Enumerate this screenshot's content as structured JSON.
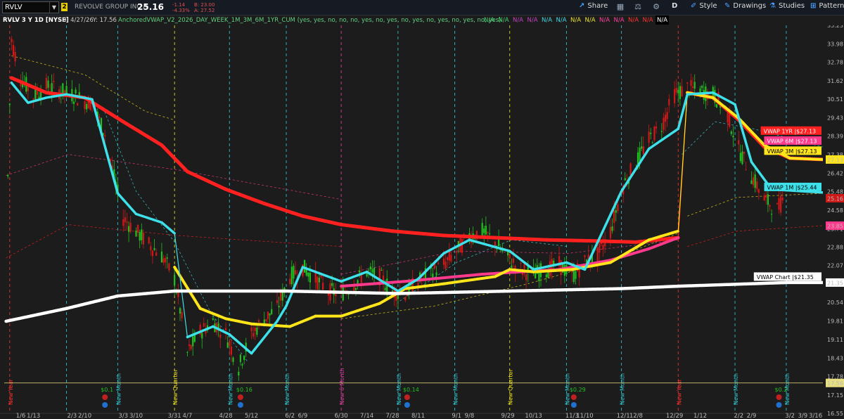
{
  "toolbar": {
    "symbol": "RVLV",
    "link_number": "2",
    "company": "REVOLVE GROUP INC A",
    "last_price": "25.16",
    "net_change": "-1.14",
    "pct_change": "-4.33%",
    "bid": "B: 23.00",
    "ask": "A: 27.52",
    "share_label": "Share",
    "aggregation_label": "D",
    "style_label": "Style",
    "drawings_label": "Drawings",
    "studies_label": "Studies",
    "patterns_label": "Patterns"
  },
  "study_header": {
    "chart_title": "RVLV 3 Y 1D [NYSE]",
    "date_info": "D: 4/27/26",
    "y_info": "Y: 17.56",
    "study_text": "AnchoredVWAP_V2_2026_DAY_WEEK_1M_3M_6M_1YR_CUM (yes, yes, no, no, no, yes, no, yes, no, yes, no, yes, no, yes, no, yes)",
    "na_values": [
      {
        "text": "N/A",
        "color": "#40d070",
        "bg": "none"
      },
      {
        "text": "N/A",
        "color": "#40d070",
        "bg": "none"
      },
      {
        "text": "N/A",
        "color": "#c040c0",
        "bg": "none"
      },
      {
        "text": "N/A",
        "color": "#c040c0",
        "bg": "none"
      },
      {
        "text": "N/A",
        "color": "#40d8e8",
        "bg": "none"
      },
      {
        "text": "N/A",
        "color": "#40d8e8",
        "bg": "none"
      },
      {
        "text": "N/A",
        "color": "#e8e030",
        "bg": "none"
      },
      {
        "text": "N/A",
        "color": "#e8e030",
        "bg": "none"
      },
      {
        "text": "N/A",
        "color": "#ff40a0",
        "bg": "none"
      },
      {
        "text": "N/A",
        "color": "#ff40a0",
        "bg": "none"
      },
      {
        "text": "N/A",
        "color": "#ff3030",
        "bg": "none"
      },
      {
        "text": "N/A",
        "color": "#ff3030",
        "bg": "none"
      },
      {
        "text": "N/A",
        "color": "#ffffff",
        "bg": "none"
      }
    ]
  },
  "colors": {
    "background": "#1c1c1c",
    "up_candle": "#20c020",
    "down_candle": "#d01818",
    "vwap_1yr": "#ff2020",
    "vwap_6m": "#ff3a8c",
    "vwap_3m": "#ffe51a",
    "vwap_1m": "#3ee0ea",
    "vwap_chart": "#ffffff",
    "new_month": "#30c8d0",
    "new_quarter": "#e8e020",
    "new_6month": "#e040a0",
    "new_year": "#ff3030"
  },
  "chart_data": {
    "type": "candlestick",
    "y_range": [
      16.55,
      35.23
    ],
    "y_ticks": [
      35.23,
      33.98,
      32.78,
      31.62,
      30.51,
      29.43,
      28.39,
      27.38,
      26.42,
      25.48,
      24.58,
      23.71,
      22.88,
      22.07,
      21.3,
      20.54,
      19.81,
      19.11,
      18.43,
      17.78,
      17.15,
      16.55
    ],
    "x_range": [
      "2024-12-28",
      "2026-03-20"
    ],
    "x_ticks": [
      {
        "label": "1/6",
        "date": "2025-01-06"
      },
      {
        "label": "1/13",
        "date": "2025-01-13"
      },
      {
        "label": "2/3",
        "date": "2025-02-03"
      },
      {
        "label": "2/10",
        "date": "2025-02-10"
      },
      {
        "label": "3/3",
        "date": "2025-03-03"
      },
      {
        "label": "3/10",
        "date": "2025-03-10"
      },
      {
        "label": "3/31",
        "date": "2025-03-31"
      },
      {
        "label": "4/7",
        "date": "2025-04-07"
      },
      {
        "label": "4/28",
        "date": "2025-04-28"
      },
      {
        "label": "5/12",
        "date": "2025-05-12"
      },
      {
        "label": "6/2",
        "date": "2025-06-02"
      },
      {
        "label": "6/9",
        "date": "2025-06-09"
      },
      {
        "label": "6/30",
        "date": "2025-06-30"
      },
      {
        "label": "7/14",
        "date": "2025-07-14"
      },
      {
        "label": "7/28",
        "date": "2025-07-28"
      },
      {
        "label": "8/11",
        "date": "2025-08-11"
      },
      {
        "label": "9/1",
        "date": "2025-09-01"
      },
      {
        "label": "9/8",
        "date": "2025-09-08"
      },
      {
        "label": "9/29",
        "date": "2025-09-29"
      },
      {
        "label": "10/13",
        "date": "2025-10-13"
      },
      {
        "label": "11/3",
        "date": "2025-11-03"
      },
      {
        "label": "11/10",
        "date": "2025-11-10"
      },
      {
        "label": "12/1",
        "date": "2025-12-01"
      },
      {
        "label": "12/8",
        "date": "2025-12-08"
      },
      {
        "label": "12/29",
        "date": "2025-12-29"
      },
      {
        "label": "1/12",
        "date": "2026-01-12"
      },
      {
        "label": "2/2",
        "date": "2026-02-02"
      },
      {
        "label": "2/9",
        "date": "2026-02-09"
      },
      {
        "label": "3/2",
        "date": "2026-03-02"
      },
      {
        "label": "3/9",
        "date": "2026-03-09"
      },
      {
        "label": "3/16",
        "date": "2026-03-16"
      }
    ],
    "period_markers": [
      {
        "label": "New Year",
        "type": "year",
        "date": "2024-12-31"
      },
      {
        "label": "",
        "type": "month",
        "date": "2025-01-31"
      },
      {
        "label": "New Month",
        "type": "month",
        "date": "2025-02-28"
      },
      {
        "label": "New Quarter",
        "type": "quarter",
        "date": "2025-03-31"
      },
      {
        "label": "New Month",
        "type": "month",
        "date": "2025-04-30"
      },
      {
        "label": "New Month",
        "type": "month",
        "date": "2025-05-31"
      },
      {
        "label": "New 6 Month",
        "type": "halfyear",
        "date": "2025-06-30"
      },
      {
        "label": "New Month",
        "type": "month",
        "date": "2025-07-31"
      },
      {
        "label": "New Month",
        "type": "month",
        "date": "2025-08-31"
      },
      {
        "label": "New Quarter",
        "type": "quarter",
        "date": "2025-09-30"
      },
      {
        "label": "New Month",
        "type": "month",
        "date": "2025-10-31"
      },
      {
        "label": "New Month",
        "type": "month",
        "date": "2025-11-30"
      },
      {
        "label": "New Year",
        "type": "year",
        "date": "2025-12-31"
      },
      {
        "label": "New Month",
        "type": "month",
        "date": "2026-01-31"
      },
      {
        "label": "New Month",
        "type": "month",
        "date": "2026-02-28"
      }
    ],
    "earnings_events": [
      {
        "label": "$0.1",
        "date": "2025-02-21",
        "icon": "E"
      },
      {
        "label": "$0.16",
        "date": "2025-05-06",
        "icon": "E"
      },
      {
        "label": "$0.14",
        "date": "2025-08-05",
        "icon": "E"
      },
      {
        "label": "$0.29",
        "date": "2025-11-04",
        "icon": "E"
      },
      {
        "label": "$0.2",
        "date": "2026-02-24",
        "icon": "E"
      }
    ],
    "series": [
      {
        "name": "Price",
        "points": [
          [
            "2024-12-29",
            22.3
          ],
          [
            "2025-01-01",
            34.2
          ],
          [
            "2025-01-06",
            31.8
          ],
          [
            "2025-01-13",
            30.7
          ],
          [
            "2025-01-20",
            31.3
          ],
          [
            "2025-02-03",
            30.8
          ],
          [
            "2025-02-10",
            30.4
          ],
          [
            "2025-02-14",
            30.3
          ],
          [
            "2025-02-21",
            28.5
          ],
          [
            "2025-02-26",
            26.2
          ],
          [
            "2025-03-03",
            24.2
          ],
          [
            "2025-03-10",
            23.6
          ],
          [
            "2025-03-17",
            23.0
          ],
          [
            "2025-03-24",
            22.5
          ],
          [
            "2025-03-31",
            21.5
          ],
          [
            "2025-04-07",
            18.6
          ],
          [
            "2025-04-14",
            19.4
          ],
          [
            "2025-04-21",
            19.8
          ],
          [
            "2025-04-28",
            19.3
          ],
          [
            "2025-05-05",
            18.1
          ],
          [
            "2025-05-12",
            19.3
          ],
          [
            "2025-05-19",
            19.9
          ],
          [
            "2025-05-26",
            20.3
          ],
          [
            "2025-06-02",
            21.6
          ],
          [
            "2025-06-09",
            22.0
          ],
          [
            "2025-06-16",
            21.5
          ],
          [
            "2025-06-23",
            21.0
          ],
          [
            "2025-06-30",
            20.9
          ],
          [
            "2025-07-07",
            21.3
          ],
          [
            "2025-07-14",
            21.8
          ],
          [
            "2025-07-21",
            21.6
          ],
          [
            "2025-07-28",
            21.0
          ],
          [
            "2025-08-04",
            20.9
          ],
          [
            "2025-08-11",
            21.4
          ],
          [
            "2025-08-18",
            21.8
          ],
          [
            "2025-08-25",
            22.1
          ],
          [
            "2025-09-01",
            22.7
          ],
          [
            "2025-09-08",
            23.4
          ],
          [
            "2025-09-15",
            23.6
          ],
          [
            "2025-09-22",
            23.1
          ],
          [
            "2025-09-29",
            22.4
          ],
          [
            "2025-10-06",
            21.9
          ],
          [
            "2025-10-13",
            21.7
          ],
          [
            "2025-10-20",
            21.9
          ],
          [
            "2025-10-27",
            22.1
          ],
          [
            "2025-11-03",
            21.6
          ],
          [
            "2025-11-10",
            22.2
          ],
          [
            "2025-11-17",
            22.5
          ],
          [
            "2025-11-24",
            23.6
          ],
          [
            "2025-12-01",
            25.8
          ],
          [
            "2025-12-08",
            27.0
          ],
          [
            "2025-12-15",
            28.2
          ],
          [
            "2025-12-22",
            29.0
          ],
          [
            "2025-12-29",
            30.8
          ],
          [
            "2026-01-05",
            31.2
          ],
          [
            "2026-01-12",
            31.0
          ],
          [
            "2026-01-19",
            30.8
          ],
          [
            "2026-01-26",
            29.9
          ],
          [
            "2026-02-02",
            27.7
          ],
          [
            "2026-02-09",
            26.3
          ],
          [
            "2026-02-16",
            25.1
          ],
          [
            "2026-02-23",
            24.6
          ],
          [
            "2026-02-27",
            25.2
          ]
        ]
      },
      {
        "name": "VWAP 1YR",
        "last_value": "27.13",
        "points": [
          [
            "2025-01-01",
            31.8
          ],
          [
            "2025-01-20",
            30.9
          ],
          [
            "2025-02-10",
            30.6
          ],
          [
            "2025-03-03",
            29.2
          ],
          [
            "2025-03-24",
            27.9
          ],
          [
            "2025-04-07",
            26.5
          ],
          [
            "2025-04-28",
            25.6
          ],
          [
            "2025-05-19",
            24.9
          ],
          [
            "2025-06-09",
            24.3
          ],
          [
            "2025-06-30",
            23.9
          ],
          [
            "2025-07-28",
            23.6
          ],
          [
            "2025-08-25",
            23.4
          ],
          [
            "2025-09-22",
            23.3
          ],
          [
            "2025-10-20",
            23.2
          ],
          [
            "2025-11-17",
            23.15
          ],
          [
            "2025-12-08",
            23.1
          ],
          [
            "2025-12-31",
            23.3
          ],
          [
            "2026-01-05",
            30.9
          ],
          [
            "2026-01-19",
            30.6
          ],
          [
            "2026-02-02",
            29.3
          ],
          [
            "2026-02-16",
            27.8
          ],
          [
            "2026-03-02",
            27.2
          ],
          [
            "2026-03-20",
            27.13
          ]
        ]
      },
      {
        "name": "VWAP 6M",
        "last_value": "27.13",
        "points": [
          [
            "2025-06-30",
            21.2
          ],
          [
            "2025-08-04",
            21.4
          ],
          [
            "2025-09-15",
            21.7
          ],
          [
            "2025-10-27",
            21.9
          ],
          [
            "2025-11-24",
            22.3
          ],
          [
            "2025-12-15",
            22.8
          ],
          [
            "2025-12-31",
            23.3
          ]
        ]
      },
      {
        "name": "VWAP 3M",
        "last_value": "27.13",
        "points": [
          [
            "2025-03-31",
            22.0
          ],
          [
            "2025-04-14",
            20.3
          ],
          [
            "2025-04-28",
            19.9
          ],
          [
            "2025-05-12",
            19.7
          ],
          [
            "2025-06-02",
            19.6
          ],
          [
            "2025-06-16",
            20.0
          ],
          [
            "2025-06-30",
            20.0
          ],
          [
            "2025-07-21",
            20.5
          ],
          [
            "2025-08-04",
            21.1
          ],
          [
            "2025-08-25",
            21.3
          ],
          [
            "2025-09-22",
            21.6
          ],
          [
            "2025-09-30",
            21.9
          ],
          [
            "2025-10-13",
            21.8
          ],
          [
            "2025-11-03",
            21.9
          ],
          [
            "2025-11-24",
            22.2
          ],
          [
            "2025-12-15",
            23.2
          ],
          [
            "2025-12-31",
            23.6
          ],
          [
            "2026-01-05",
            30.9
          ],
          [
            "2026-01-19",
            30.6
          ],
          [
            "2026-02-02",
            29.4
          ],
          [
            "2026-02-16",
            27.9
          ],
          [
            "2026-03-02",
            27.2
          ],
          [
            "2026-03-20",
            27.13
          ]
        ]
      },
      {
        "name": "VWAP 1M",
        "last_value": "25.44",
        "points": [
          [
            "2025-01-01",
            31.5
          ],
          [
            "2025-01-10",
            30.3
          ],
          [
            "2025-01-20",
            30.6
          ],
          [
            "2025-01-31",
            30.8
          ],
          [
            "2025-02-14",
            30.5
          ],
          [
            "2025-02-28",
            25.4
          ],
          [
            "2025-03-10",
            24.4
          ],
          [
            "2025-03-24",
            24.0
          ],
          [
            "2025-03-31",
            23.5
          ],
          [
            "2025-04-07",
            19.2
          ],
          [
            "2025-04-21",
            19.6
          ],
          [
            "2025-04-30",
            19.3
          ],
          [
            "2025-05-12",
            18.6
          ],
          [
            "2025-05-26",
            19.8
          ],
          [
            "2025-05-31",
            20.4
          ],
          [
            "2025-06-09",
            22.0
          ],
          [
            "2025-06-30",
            21.4
          ],
          [
            "2025-07-14",
            21.8
          ],
          [
            "2025-07-31",
            21.0
          ],
          [
            "2025-08-11",
            21.5
          ],
          [
            "2025-08-25",
            22.6
          ],
          [
            "2025-09-08",
            23.2
          ],
          [
            "2025-09-30",
            22.7
          ],
          [
            "2025-10-13",
            21.9
          ],
          [
            "2025-10-31",
            22.2
          ],
          [
            "2025-11-10",
            21.9
          ],
          [
            "2025-11-30",
            25.5
          ],
          [
            "2025-12-15",
            27.7
          ],
          [
            "2025-12-31",
            28.8
          ],
          [
            "2026-01-05",
            30.8
          ],
          [
            "2026-01-19",
            30.9
          ],
          [
            "2026-01-31",
            30.2
          ],
          [
            "2026-02-09",
            27.0
          ],
          [
            "2026-02-20",
            25.6
          ],
          [
            "2026-03-20",
            25.44
          ]
        ]
      },
      {
        "name": "VWAP Chart",
        "last_value": "21.35",
        "points": [
          [
            "2024-12-29",
            19.8
          ],
          [
            "2025-01-31",
            20.3
          ],
          [
            "2025-02-28",
            20.8
          ],
          [
            "2025-03-31",
            21.0
          ],
          [
            "2025-05-31",
            21.0
          ],
          [
            "2025-07-31",
            20.9
          ],
          [
            "2025-09-30",
            21.0
          ],
          [
            "2025-11-30",
            21.1
          ],
          [
            "2025-12-31",
            21.2
          ],
          [
            "2026-02-28",
            21.35
          ],
          [
            "2026-03-20",
            21.35
          ]
        ]
      }
    ],
    "price_labels": [
      {
        "text": "27.13",
        "value": 27.13,
        "color": "#ffe51a"
      },
      {
        "text": "25.16",
        "value": 25.16,
        "color": "#d01818"
      },
      {
        "text": "23.85",
        "value": 23.85,
        "color": "#ff3a8c"
      },
      {
        "text": "21.35",
        "value": 21.35,
        "color": "#ffffff"
      },
      {
        "text": "17.56",
        "value": 17.56,
        "color": "#e8e080"
      }
    ],
    "vwap_labels": [
      {
        "text": "VWAP 1YR |$27.13",
        "value": 28.7,
        "color": "#ff2020"
      },
      {
        "text": "VWAP 6M |$27.13",
        "value": 28.15,
        "color": "#ff3a8c"
      },
      {
        "text": "VWAP 3M |$27.13",
        "value": 27.6,
        "color": "#ffe51a"
      },
      {
        "text": "VWAP 1M |$25.44",
        "value": 25.72,
        "color": "#3ee0ea"
      },
      {
        "text": "VWAP Chart |$21.35",
        "value": 21.6,
        "color": "#ffffff"
      }
    ],
    "crosshair_y": 17.56
  }
}
